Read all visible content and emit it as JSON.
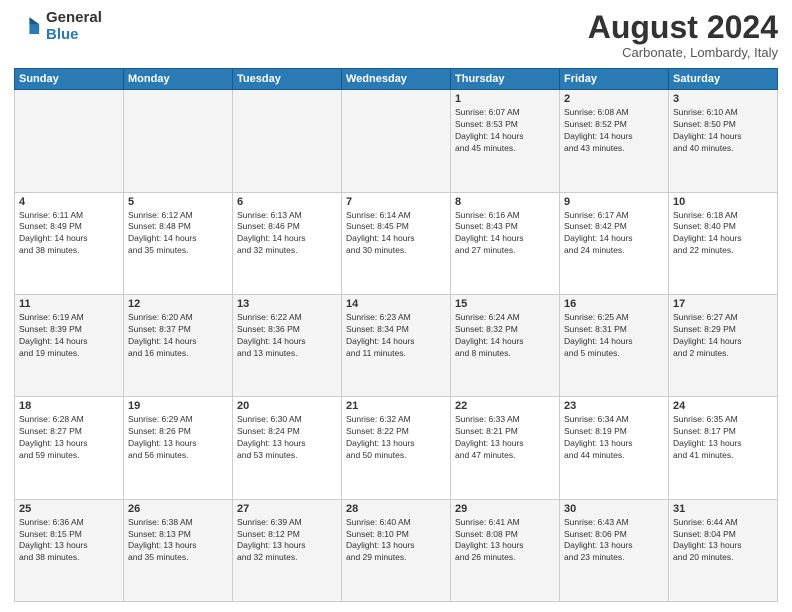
{
  "logo": {
    "general": "General",
    "blue": "Blue"
  },
  "header": {
    "title": "August 2024",
    "subtitle": "Carbonate, Lombardy, Italy"
  },
  "days_of_week": [
    "Sunday",
    "Monday",
    "Tuesday",
    "Wednesday",
    "Thursday",
    "Friday",
    "Saturday"
  ],
  "weeks": [
    [
      {
        "day": "",
        "info": ""
      },
      {
        "day": "",
        "info": ""
      },
      {
        "day": "",
        "info": ""
      },
      {
        "day": "",
        "info": ""
      },
      {
        "day": "1",
        "info": "Sunrise: 6:07 AM\nSunset: 8:53 PM\nDaylight: 14 hours\nand 45 minutes."
      },
      {
        "day": "2",
        "info": "Sunrise: 6:08 AM\nSunset: 8:52 PM\nDaylight: 14 hours\nand 43 minutes."
      },
      {
        "day": "3",
        "info": "Sunrise: 6:10 AM\nSunset: 8:50 PM\nDaylight: 14 hours\nand 40 minutes."
      }
    ],
    [
      {
        "day": "4",
        "info": "Sunrise: 6:11 AM\nSunset: 8:49 PM\nDaylight: 14 hours\nand 38 minutes."
      },
      {
        "day": "5",
        "info": "Sunrise: 6:12 AM\nSunset: 8:48 PM\nDaylight: 14 hours\nand 35 minutes."
      },
      {
        "day": "6",
        "info": "Sunrise: 6:13 AM\nSunset: 8:46 PM\nDaylight: 14 hours\nand 32 minutes."
      },
      {
        "day": "7",
        "info": "Sunrise: 6:14 AM\nSunset: 8:45 PM\nDaylight: 14 hours\nand 30 minutes."
      },
      {
        "day": "8",
        "info": "Sunrise: 6:16 AM\nSunset: 8:43 PM\nDaylight: 14 hours\nand 27 minutes."
      },
      {
        "day": "9",
        "info": "Sunrise: 6:17 AM\nSunset: 8:42 PM\nDaylight: 14 hours\nand 24 minutes."
      },
      {
        "day": "10",
        "info": "Sunrise: 6:18 AM\nSunset: 8:40 PM\nDaylight: 14 hours\nand 22 minutes."
      }
    ],
    [
      {
        "day": "11",
        "info": "Sunrise: 6:19 AM\nSunset: 8:39 PM\nDaylight: 14 hours\nand 19 minutes."
      },
      {
        "day": "12",
        "info": "Sunrise: 6:20 AM\nSunset: 8:37 PM\nDaylight: 14 hours\nand 16 minutes."
      },
      {
        "day": "13",
        "info": "Sunrise: 6:22 AM\nSunset: 8:36 PM\nDaylight: 14 hours\nand 13 minutes."
      },
      {
        "day": "14",
        "info": "Sunrise: 6:23 AM\nSunset: 8:34 PM\nDaylight: 14 hours\nand 11 minutes."
      },
      {
        "day": "15",
        "info": "Sunrise: 6:24 AM\nSunset: 8:32 PM\nDaylight: 14 hours\nand 8 minutes."
      },
      {
        "day": "16",
        "info": "Sunrise: 6:25 AM\nSunset: 8:31 PM\nDaylight: 14 hours\nand 5 minutes."
      },
      {
        "day": "17",
        "info": "Sunrise: 6:27 AM\nSunset: 8:29 PM\nDaylight: 14 hours\nand 2 minutes."
      }
    ],
    [
      {
        "day": "18",
        "info": "Sunrise: 6:28 AM\nSunset: 8:27 PM\nDaylight: 13 hours\nand 59 minutes."
      },
      {
        "day": "19",
        "info": "Sunrise: 6:29 AM\nSunset: 8:26 PM\nDaylight: 13 hours\nand 56 minutes."
      },
      {
        "day": "20",
        "info": "Sunrise: 6:30 AM\nSunset: 8:24 PM\nDaylight: 13 hours\nand 53 minutes."
      },
      {
        "day": "21",
        "info": "Sunrise: 6:32 AM\nSunset: 8:22 PM\nDaylight: 13 hours\nand 50 minutes."
      },
      {
        "day": "22",
        "info": "Sunrise: 6:33 AM\nSunset: 8:21 PM\nDaylight: 13 hours\nand 47 minutes."
      },
      {
        "day": "23",
        "info": "Sunrise: 6:34 AM\nSunset: 8:19 PM\nDaylight: 13 hours\nand 44 minutes."
      },
      {
        "day": "24",
        "info": "Sunrise: 6:35 AM\nSunset: 8:17 PM\nDaylight: 13 hours\nand 41 minutes."
      }
    ],
    [
      {
        "day": "25",
        "info": "Sunrise: 6:36 AM\nSunset: 8:15 PM\nDaylight: 13 hours\nand 38 minutes."
      },
      {
        "day": "26",
        "info": "Sunrise: 6:38 AM\nSunset: 8:13 PM\nDaylight: 13 hours\nand 35 minutes."
      },
      {
        "day": "27",
        "info": "Sunrise: 6:39 AM\nSunset: 8:12 PM\nDaylight: 13 hours\nand 32 minutes."
      },
      {
        "day": "28",
        "info": "Sunrise: 6:40 AM\nSunset: 8:10 PM\nDaylight: 13 hours\nand 29 minutes."
      },
      {
        "day": "29",
        "info": "Sunrise: 6:41 AM\nSunset: 8:08 PM\nDaylight: 13 hours\nand 26 minutes."
      },
      {
        "day": "30",
        "info": "Sunrise: 6:43 AM\nSunset: 8:06 PM\nDaylight: 13 hours\nand 23 minutes."
      },
      {
        "day": "31",
        "info": "Sunrise: 6:44 AM\nSunset: 8:04 PM\nDaylight: 13 hours\nand 20 minutes."
      }
    ]
  ]
}
